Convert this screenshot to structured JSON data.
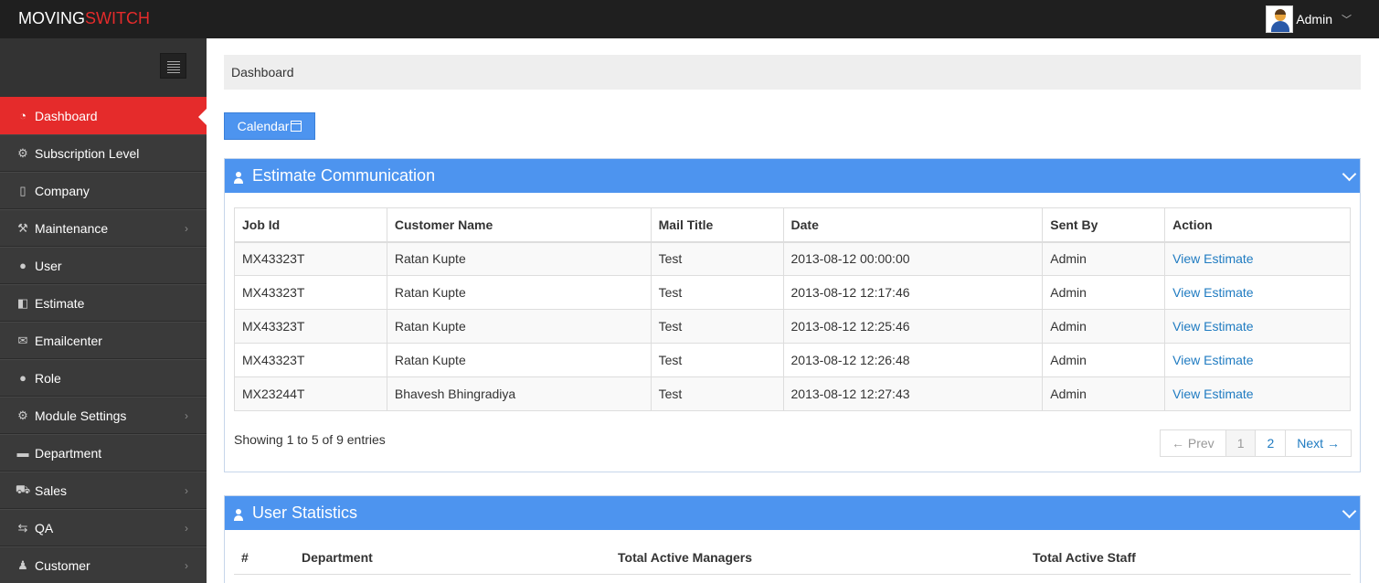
{
  "app": {
    "brand_part1": "MOVING",
    "brand_part2": "SWITCH"
  },
  "user": {
    "name": "Admin"
  },
  "sidebar": {
    "items": [
      {
        "label": "Dashboard",
        "icon": "dashboard-icon",
        "glyph": "◔",
        "active": true,
        "has_children": false
      },
      {
        "label": "Subscription Level",
        "icon": "gear-icon",
        "glyph": "⚙",
        "has_children": false
      },
      {
        "label": "Company",
        "icon": "building-icon",
        "glyph": "▯",
        "has_children": false
      },
      {
        "label": "Maintenance",
        "icon": "wrench-icon",
        "glyph": "⚒",
        "has_children": true
      },
      {
        "label": "User",
        "icon": "user-icon",
        "glyph": "●",
        "has_children": false
      },
      {
        "label": "Estimate",
        "icon": "columns-icon",
        "glyph": "◧",
        "has_children": false
      },
      {
        "label": "Emailcenter",
        "icon": "envelope-icon",
        "glyph": "✉",
        "has_children": false
      },
      {
        "label": "Role",
        "icon": "users-icon",
        "glyph": "●",
        "has_children": false
      },
      {
        "label": "Module Settings",
        "icon": "gears-icon",
        "glyph": "⚙",
        "has_children": true
      },
      {
        "label": "Department",
        "icon": "briefcase-icon",
        "glyph": "▬",
        "has_children": false
      },
      {
        "label": "Sales",
        "icon": "cart-icon",
        "glyph": "⛟",
        "has_children": true
      },
      {
        "label": "QA",
        "icon": "retweet-icon",
        "glyph": "⇆",
        "has_children": true
      },
      {
        "label": "Customer",
        "icon": "male-icon",
        "glyph": "♟",
        "has_children": true
      }
    ]
  },
  "breadcrumb": {
    "label": "Dashboard"
  },
  "calendar_button": {
    "label": "Calendar"
  },
  "estimate_panel": {
    "title": "Estimate Communication",
    "columns": [
      "Job Id",
      "Customer Name",
      "Mail Title",
      "Date",
      "Sent By",
      "Action"
    ],
    "rows": [
      [
        "MX43323T",
        "Ratan Kupte",
        "Test",
        "2013-08-12 00:00:00",
        "Admin",
        "View Estimate"
      ],
      [
        "MX43323T",
        "Ratan Kupte",
        "Test",
        "2013-08-12 12:17:46",
        "Admin",
        "View Estimate"
      ],
      [
        "MX43323T",
        "Ratan Kupte",
        "Test",
        "2013-08-12 12:25:46",
        "Admin",
        "View Estimate"
      ],
      [
        "MX43323T",
        "Ratan Kupte",
        "Test",
        "2013-08-12 12:26:48",
        "Admin",
        "View Estimate"
      ],
      [
        "MX23244T",
        "Bhavesh Bhingradiya",
        "Test",
        "2013-08-12 12:27:43",
        "Admin",
        "View Estimate"
      ]
    ],
    "showing": "Showing 1 to 5 of 9 entries",
    "pager": {
      "prev": "← Prev",
      "pages": [
        "1",
        "2"
      ],
      "current": "1",
      "next": "Next →"
    }
  },
  "stats_panel": {
    "title": "User Statistics",
    "columns": [
      "#",
      "Department",
      "Total Active Managers",
      "Total Active Staff"
    ]
  }
}
